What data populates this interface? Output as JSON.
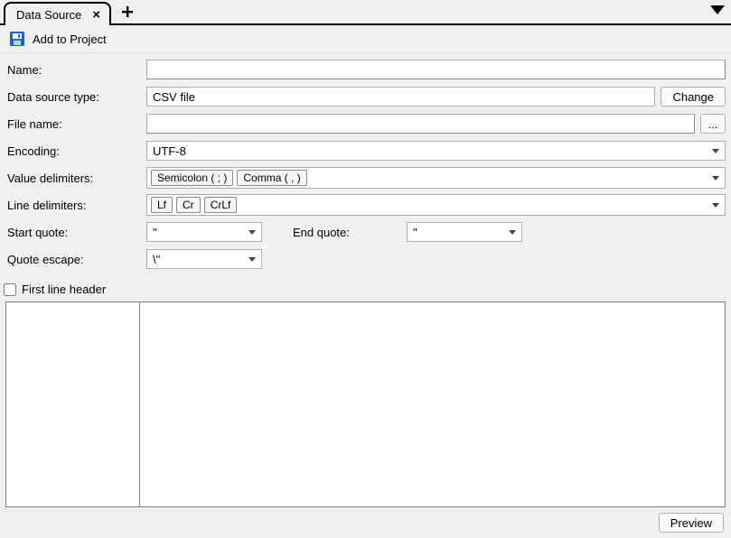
{
  "tab": {
    "label": "Data Source"
  },
  "toolbar": {
    "add_to_project": "Add to Project"
  },
  "labels": {
    "name": "Name:",
    "data_source_type": "Data source type:",
    "file_name": "File name:",
    "encoding": "Encoding:",
    "value_delimiters": "Value delimiters:",
    "line_delimiters": "Line delimiters:",
    "start_quote": "Start quote:",
    "end_quote": "End quote:",
    "quote_escape": "Quote escape:",
    "first_line_header": "First line header"
  },
  "values": {
    "name": "",
    "data_source_type": "CSV file",
    "file_name": "",
    "encoding": "UTF-8",
    "start_quote": "\"",
    "end_quote": "\"",
    "quote_escape": "\\\""
  },
  "value_delimiter_chips": [
    "Semicolon ( ; )",
    "Comma ( , )"
  ],
  "line_delimiter_chips": [
    "Lf",
    "Cr",
    "CrLf"
  ],
  "buttons": {
    "change": "Change",
    "browse": "...",
    "preview": "Preview"
  }
}
